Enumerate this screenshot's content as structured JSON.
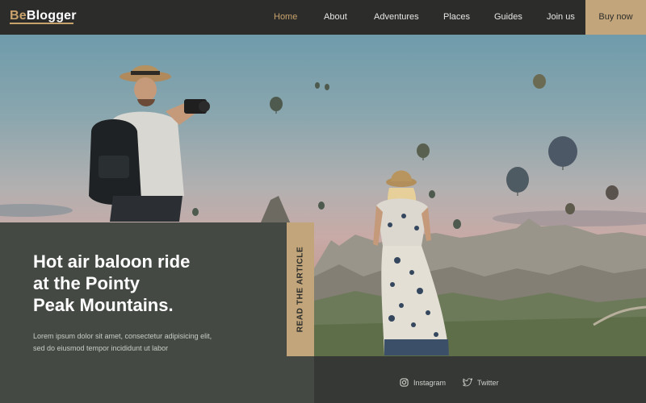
{
  "brand": {
    "prefix": "Be",
    "name": "Blogger"
  },
  "nav": {
    "items": [
      {
        "label": "Home",
        "active": true
      },
      {
        "label": "About",
        "active": false
      },
      {
        "label": "Adventures",
        "active": false
      },
      {
        "label": "Places",
        "active": false
      },
      {
        "label": "Guides",
        "active": false
      },
      {
        "label": "Join us",
        "active": false
      }
    ],
    "cta": "Buy now"
  },
  "article": {
    "title_lines": [
      "Hot air baloon ride",
      "at the Pointy",
      "Peak Mountains."
    ],
    "excerpt_lines": [
      "Lorem ipsum dolor sit amet, consectetur adipisicing elit,",
      "sed do eiusmod tempor incididunt ut labor"
    ],
    "read_label": "READ THE ARTICLE"
  },
  "social": {
    "instagram": "Instagram",
    "twitter": "Twitter"
  },
  "colors": {
    "accent": "#c8a26b",
    "nav_bg": "#2c2d2b",
    "card_bg": "#444a43",
    "button_bg": "#c2a57a"
  },
  "icons": {
    "instagram": "instagram-icon",
    "twitter": "twitter-icon"
  }
}
